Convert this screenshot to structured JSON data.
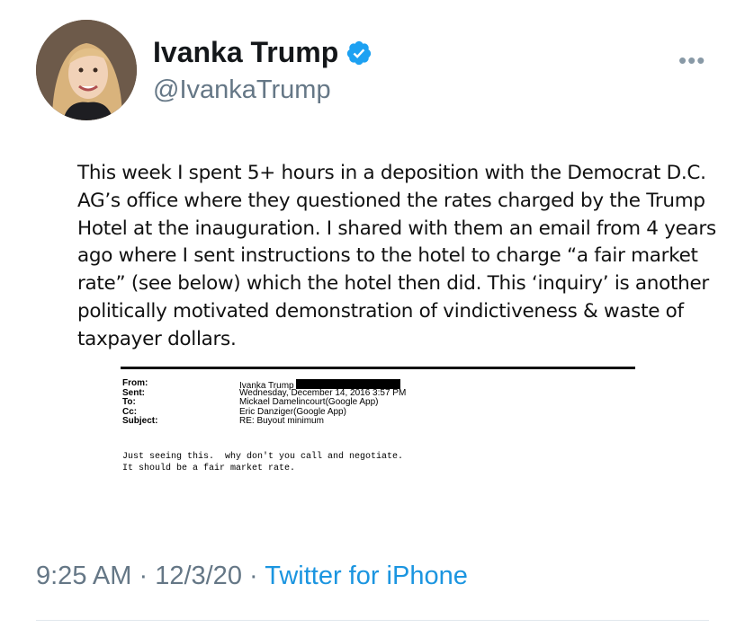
{
  "author": {
    "name": "Ivanka Trump",
    "handle": "@IvankaTrump",
    "verified_icon": "verified-badge-icon",
    "verified_color": "#1da1f2"
  },
  "more_icon": "•••",
  "tweet": {
    "lines": [
      "This week I spent 5+ hours in a deposition with the Democrat D.C.",
      "AG’s office where they questioned the rates charged by the Trump",
      "Hotel at the inauguration. I shared with them an email from 4 years",
      "ago where I sent instructions to the hotel to charge “a fair market",
      "rate” (see below) which the hotel then did.  This ‘inquiry’ is another",
      "politically motivated demonstration of vindictiveness & waste of",
      "taxpayer dollars."
    ]
  },
  "email": {
    "from_label": "From:",
    "from_value": "Ivanka Trump",
    "sent_label": "Sent:",
    "sent_value": "Wednesday, December 14, 2016 3:57 PM",
    "to_label": "To:",
    "to_value": "Mickael Damelincourt(Google App)",
    "cc_label": "Cc:",
    "cc_value": "Eric Danziger(Google App)",
    "subject_label": "Subject:",
    "subject_value": "RE: Buyout minimum",
    "body_line1": "Just seeing this.  why don't you call and negotiate.",
    "body_line2": "It should be a fair market rate."
  },
  "meta": {
    "time": "9:25 AM",
    "sep1": " · ",
    "date": "12/3/20",
    "sep2": " · ",
    "source": "Twitter for iPhone"
  }
}
